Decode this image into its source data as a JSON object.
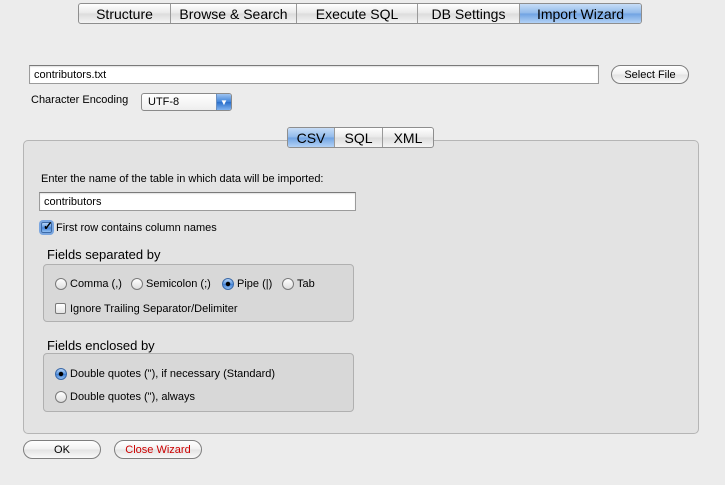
{
  "top_tabs": [
    "Structure",
    "Browse & Search",
    "Execute SQL",
    "DB Settings",
    "Import Wizard"
  ],
  "file": {
    "path": "contributors.txt",
    "select_label": "Select File"
  },
  "encoding": {
    "label": "Character Encoding",
    "value": "UTF-8"
  },
  "format_tabs": [
    "CSV",
    "SQL",
    "XML"
  ],
  "table": {
    "prompt": "Enter the name of the table in which data will be imported:",
    "name": "contributors"
  },
  "first_row": {
    "label": "First row contains column names",
    "checked": true
  },
  "separated": {
    "title": "Fields separated by",
    "options": [
      "Comma (,)",
      "Semicolon (;)",
      "Pipe (|)",
      "Tab"
    ],
    "selected": "Pipe (|)",
    "ignore_label": "Ignore Trailing Separator/Delimiter"
  },
  "enclosed": {
    "title": "Fields enclosed by",
    "options": [
      "Double quotes (\"), if necessary (Standard)",
      "Double quotes (\"), always"
    ],
    "selected": "Double quotes (\"), if necessary (Standard)"
  },
  "buttons": {
    "ok": "OK",
    "close": "Close Wizard"
  },
  "colors": {
    "close_text": "#cc0000",
    "selected_tab": "#8fb8ea"
  }
}
